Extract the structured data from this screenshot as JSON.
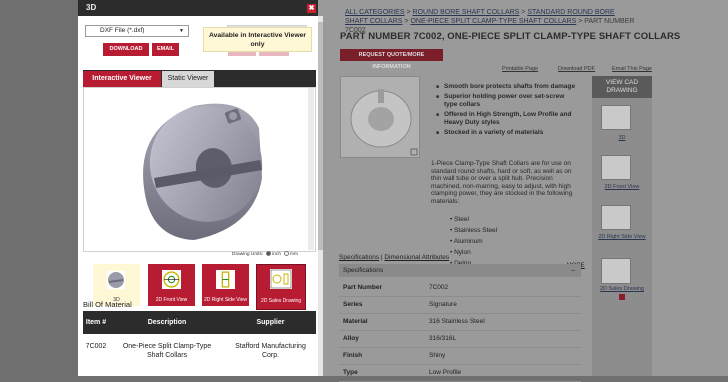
{
  "page": {
    "breadcrumb": {
      "items": [
        "ALL CATEGORIES",
        "ROUND BORE SHAFT COLLARS",
        "STANDARD ROUND BORE SHAFT COLLARS",
        "ONE-PIECE SPLIT CLAMP-TYPE SHAFT COLLARS"
      ],
      "sep": " > ",
      "current": "PART NUMBER 7C002"
    },
    "title": "PART NUMBER 7C002, ONE-PIECE SPLIT CLAMP-TYPE SHAFT COLLARS",
    "quote_button": "REQUEST QUOTE/MORE INFORMATION",
    "links": {
      "printable": "Printable Page",
      "pdf": "Download PDF",
      "email": "Email This Page"
    },
    "features": [
      "Smooth bore protects shafts from damage",
      "Superior holding power over set-screw type collars",
      "Offered in High Strength, Low Profile and Heavy Duty styles",
      "Stocked in a variety of materials"
    ],
    "description": "1-Piece Clamp-Type Shaft Collars are for use on standard round shafts, hard or soft, as well as on thin wall tube or over a split hub. Precision machined, non-marring, easy to adjust, with high clamping power, they are stocked in the following materials:",
    "materials": [
      "Steel",
      "Stainless Steel",
      "Aluminum",
      "Nylon",
      "Delrin"
    ],
    "more": "MORE",
    "spec_tabs": {
      "specifications": "Specifications",
      "sep": " | ",
      "dimensional": "Dimensional Attributes"
    },
    "spec_header": "Specifications",
    "spec_collapse": "–",
    "specs": [
      {
        "label": "Part Number",
        "value": "7C002"
      },
      {
        "label": "Series",
        "value": "Signature"
      },
      {
        "label": "Material",
        "value": "316 Stainless Steel"
      },
      {
        "label": "Alloy",
        "value": "316/316L"
      },
      {
        "label": "Finish",
        "value": "Shiny"
      },
      {
        "label": "Type",
        "value": "Low Profile"
      }
    ],
    "cad_panel": {
      "title_line1": "VIEW CAD",
      "title_line2": "DRAWING",
      "items": [
        "3D",
        "2D Front View",
        "2D Right Side View",
        "2D Sales Drawing"
      ]
    }
  },
  "modal": {
    "title": "3D",
    "close_icon": "✖",
    "format_value": "DXF File (*.dxf)",
    "download_label": "DOWNLOAD",
    "email_label": "EMAIL",
    "insert_label": "INSERT",
    "options_label": "OPTIONS",
    "tooltip": "Available in Interactive Viewer only",
    "tabs": {
      "interactive": "Interactive Viewer",
      "static": "Static Viewer"
    },
    "units": {
      "label": "Drawing Units:",
      "inch": "inch",
      "mm": "mm",
      "selected": "inch"
    },
    "thumbnails": [
      "3D",
      "2D Front View",
      "2D Right Side View",
      "2D Sales Drawing"
    ],
    "bom": {
      "title": "Bill Of Material",
      "headers": [
        "Item #",
        "Description",
        "Supplier"
      ],
      "rows": [
        {
          "item": "7C002",
          "description": "One-Piece Split Clamp-Type Shaft Collars",
          "supplier": "Stafford Manufacturing Corp."
        }
      ]
    }
  },
  "colors": {
    "accent": "#b71c32",
    "header": "#2c2c2c",
    "tooltip_bg": "#fff8d6"
  }
}
